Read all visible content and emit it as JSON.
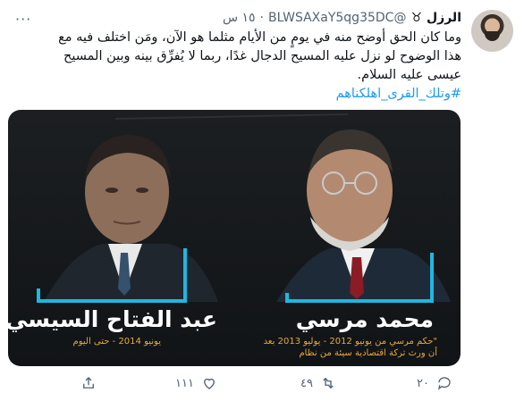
{
  "author": {
    "display_name": "الرزل",
    "handle": "@BLWSAXaY5qg35DC",
    "separator": "·",
    "time": "١٥ س",
    "avatar_icon": "person-photo"
  },
  "tweet": {
    "body": "وما كان الحق أوضح منه في يومٍ من الأيام مثلما هو الآن، ومَن اختلف فيه مع هذا الوضوح لو نزل عليه المسيح الدجال غدًا، ربما لا يُفرِّق بينه وبين المسيح عيسى عليه السلام.",
    "hashtag": "#وتلك_القرى_اهلكناهم"
  },
  "media": {
    "left_person_name": "عبد الفتاح السيسي",
    "left_person_period": "يونيو 2014 - حتى اليوم",
    "right_person_name": "محمد مرسي",
    "right_person_note_1": "\"حكم مرسي من يونيو 2012 - يوليو 2013 بعد",
    "right_person_note_2": "أن ورث تركة اقتصادية سيئة من نظام",
    "accent_color": "#1fb7e0",
    "note_color": "#e8a838"
  },
  "actions": {
    "reply_count": "٢٠",
    "retweet_count": "٤٩",
    "like_count": "١١١",
    "share_icon": "share-icon"
  }
}
